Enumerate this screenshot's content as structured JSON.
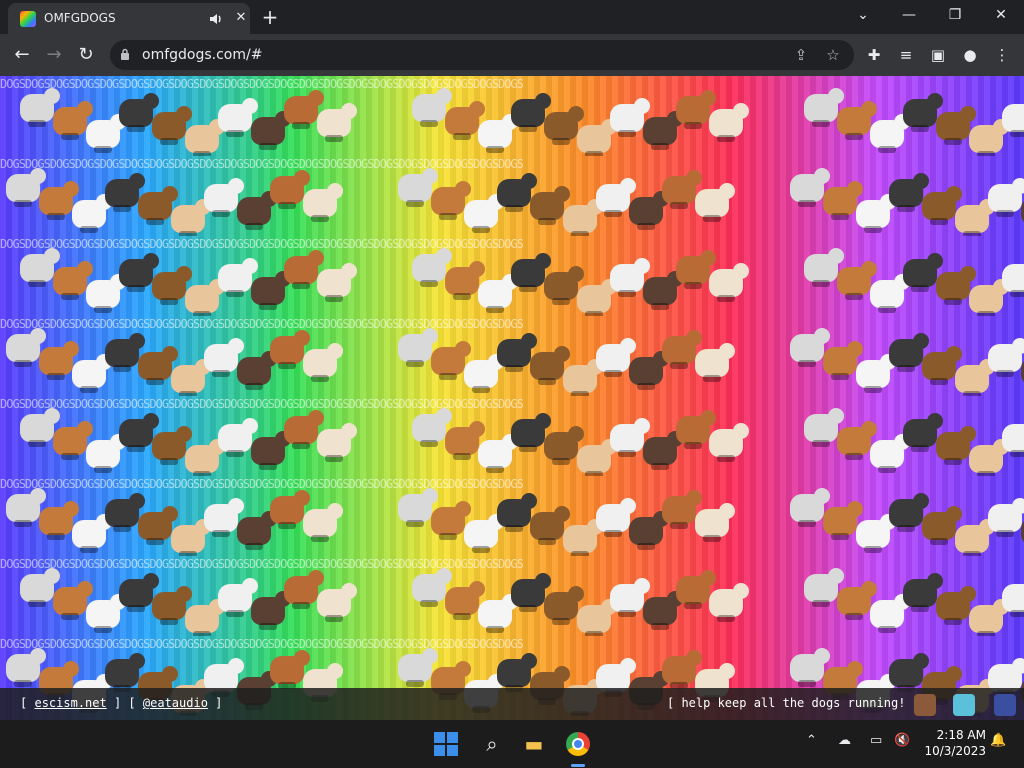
{
  "browser": {
    "tab_title": "OMFGDOGS",
    "tab_close": "✕",
    "new_tab": "+",
    "url": "omfgdogs.com/#",
    "window_controls": {
      "dropdown": "⌄",
      "minimize": "—",
      "restore": "❐",
      "close": "✕"
    },
    "nav": {
      "back": "←",
      "forward": "→",
      "reload": "↻"
    }
  },
  "page": {
    "stripe_text": "DOGSDOGSDOGSDOGSDOGSDOGSDOGSDOGSDOGSDOGSDOGSDOGSDOGSDOGSDOGSDOGSDOGSDOGSDOGSDOGSDOGS",
    "footer": {
      "bracket_open": "[",
      "bracket_close": "]",
      "link1": "escism.net",
      "link2": "@eataudio",
      "right_text": "[ help keep all the dogs running! ]"
    }
  },
  "taskbar": {
    "time": "2:18 AM",
    "date": "10/3/2023"
  },
  "colors": {
    "chrome_dark": "#202124",
    "chrome_toolbar": "#35363a",
    "taskbar": "#1c1c1c",
    "win_blue": "#3b8eea"
  },
  "icons": [
    "favicon",
    "audio-icon",
    "lock-icon",
    "share-icon",
    "star-icon",
    "extensions-icon",
    "media-icon",
    "sidepanel-icon",
    "profile-icon",
    "menu-icon",
    "search-icon",
    "folder-icon",
    "chrome-icon",
    "onedrive-icon",
    "network-icon",
    "volume-icon",
    "bell-icon"
  ]
}
